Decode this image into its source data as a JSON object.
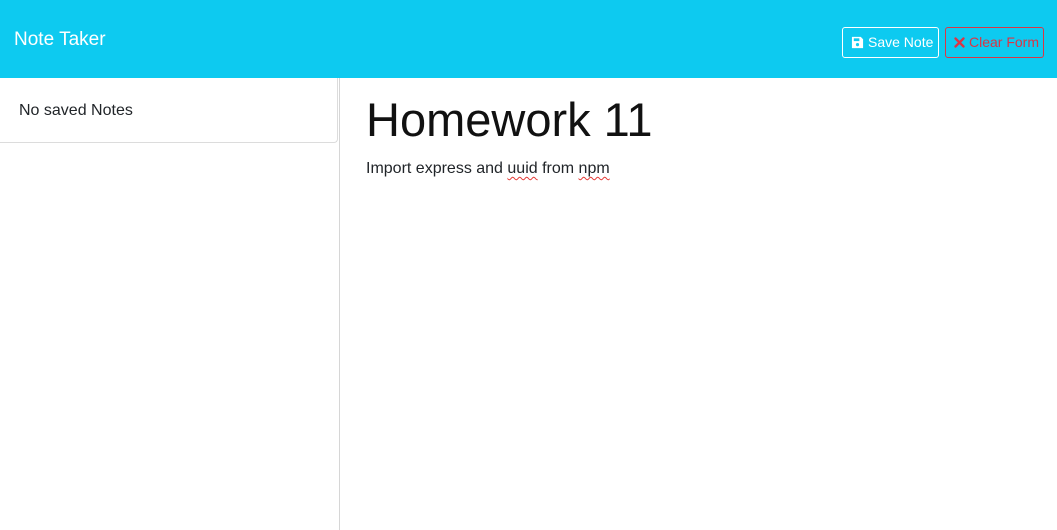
{
  "app": {
    "brand": "Note Taker"
  },
  "toolbar": {
    "save_label": "Save Note",
    "save_icon": "floppy-disk-icon",
    "clear_label": "Clear Form",
    "clear_icon": "x-icon"
  },
  "sidebar": {
    "empty_message": "No saved Notes"
  },
  "note": {
    "title": "Homework 11",
    "body_parts": [
      "Import express and ",
      "uuid",
      " from ",
      "npm"
    ]
  },
  "colors": {
    "navbar": "#0dcaf0",
    "danger": "#dc3545",
    "spellcheck": "#e53935"
  }
}
